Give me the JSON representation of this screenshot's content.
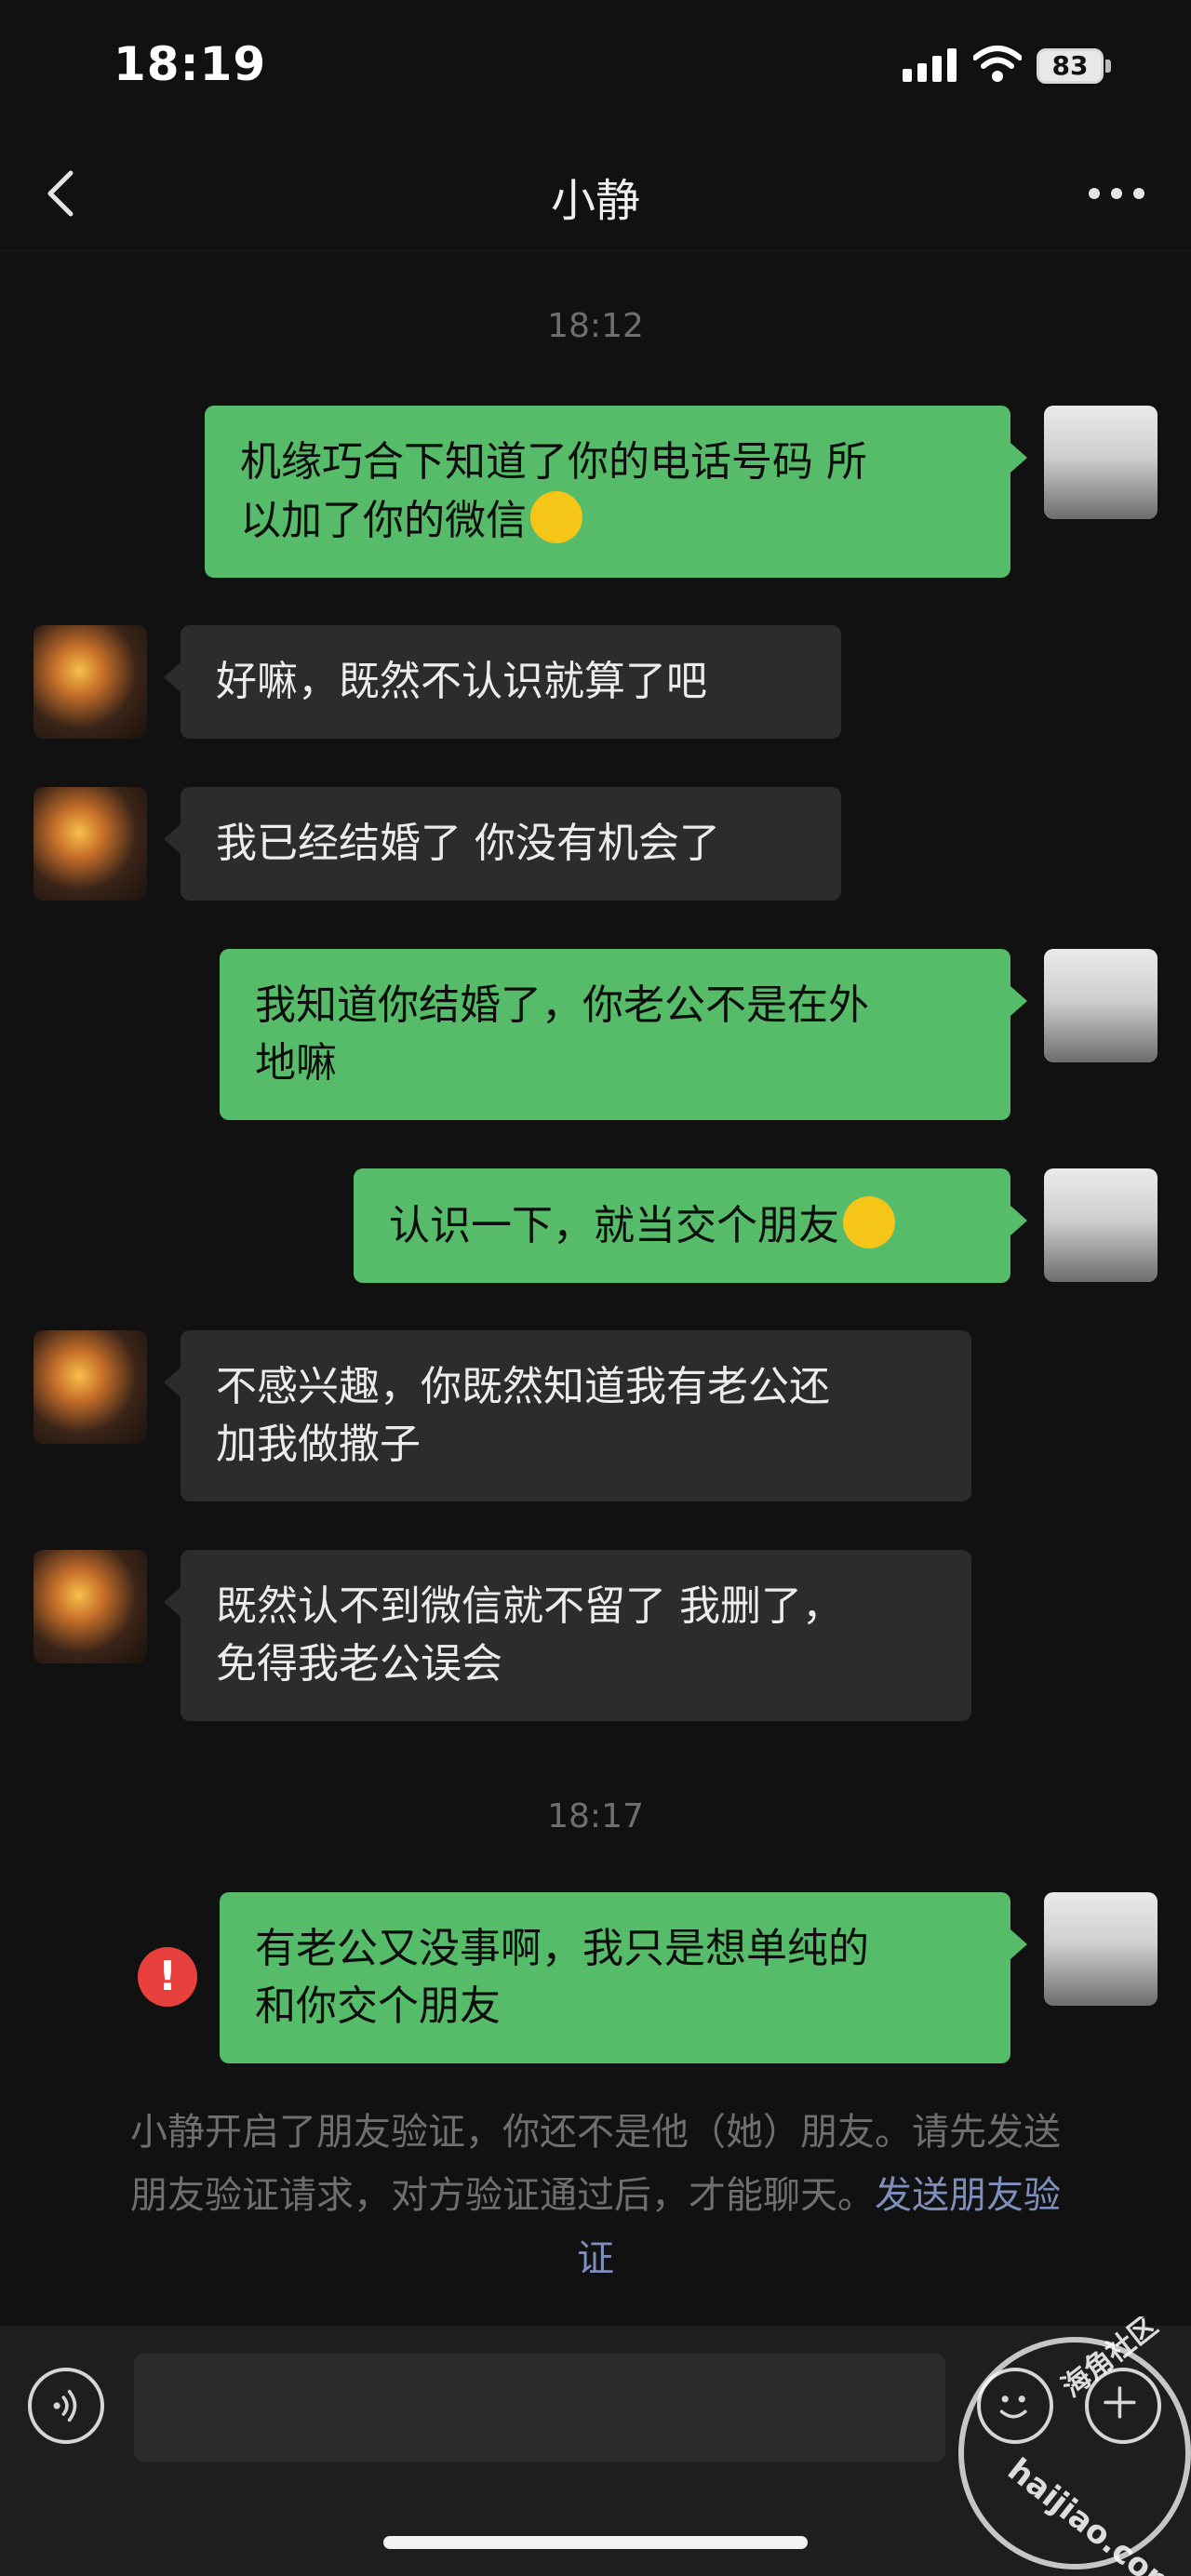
{
  "status_bar": {
    "time": "18:19",
    "battery": "83"
  },
  "nav": {
    "title": "小静"
  },
  "messages": {
    "ts1": "18:12",
    "m1": "机缘巧合下知道了你的电话号码 所",
    "m1b": "以加了你的微信",
    "m2": "好嘛，既然不认识就算了吧",
    "m3": "我已经结婚了 你没有机会了",
    "m4": "我知道你结婚了，你老公不是在外",
    "m4b": "地嘛",
    "m5": "认识一下，就当交个朋友",
    "m6": "不感兴趣，你既然知道我有老公还",
    "m6b": "加我做撒子",
    "m7": "既然认不到微信就不留了 我删了，",
    "m7b": "免得我老公误会",
    "ts2": "18:17",
    "m8": "有老公又没事啊，我只是想单纯的",
    "m8b": "和你交个朋友",
    "error_mark": "!"
  },
  "notice": {
    "line1": "小静开启了朋友验证，你还不是他（她）朋友。请先发送",
    "line2_text": "朋友验证请求，对方验证通过后，才能聊天。",
    "link_a": "发送朋友验",
    "link_b": "证"
  },
  "watermark": {
    "line1": "海角社区",
    "line2": "haijiao.com"
  },
  "icons": {
    "back": "chevron-left-icon",
    "more": "more-dots-icon",
    "voice": "voice-icon",
    "emoji": "emoji-icon",
    "plus": "plus-icon",
    "error": "error-icon"
  },
  "colors": {
    "self_bubble": "#56bc69",
    "other_bubble": "#2c2c2c",
    "background": "#111111",
    "error": "#e8403d",
    "link": "#7f8fbd"
  }
}
